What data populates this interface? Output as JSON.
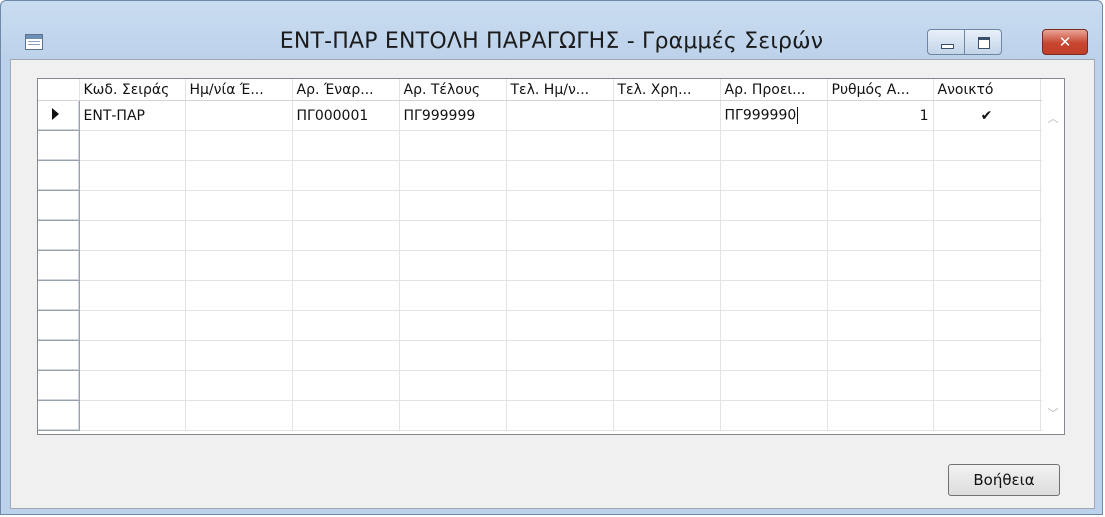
{
  "window": {
    "title": "ΕΝΤ-ΠΑΡ ΕΝΤΟΛΗ ΠΑΡΑΓΩΓΗΣ - Γραμμές Σειρών",
    "minimize_glyph": "",
    "maximize_glyph": "",
    "close_glyph": "✕"
  },
  "grid": {
    "columns": [
      "Κωδ. Σειράς",
      "Ημ/νία Έ...",
      "Αρ. Έναρ...",
      "Αρ. Τέλους",
      "Τελ. Ημ/ν...",
      "Τελ. Χρη...",
      "Αρ. Προει...",
      "Ρυθμός Α...",
      "Ανοικτό"
    ],
    "rows": [
      {
        "code": "ΕΝΤ-ΠΑΡ",
        "start_date": "",
        "start_no": "ΠΓ000001",
        "end_no": "ΠΓ999999",
        "last_date": "",
        "last_used": "",
        "warning_no": "ΠΓ999990",
        "increment": "1",
        "open": "✔"
      }
    ],
    "empty_rows": 10,
    "scroll_up_glyph": "︿",
    "scroll_down_glyph": "﹀"
  },
  "footer": {
    "help_label": "Βοήθεια"
  }
}
